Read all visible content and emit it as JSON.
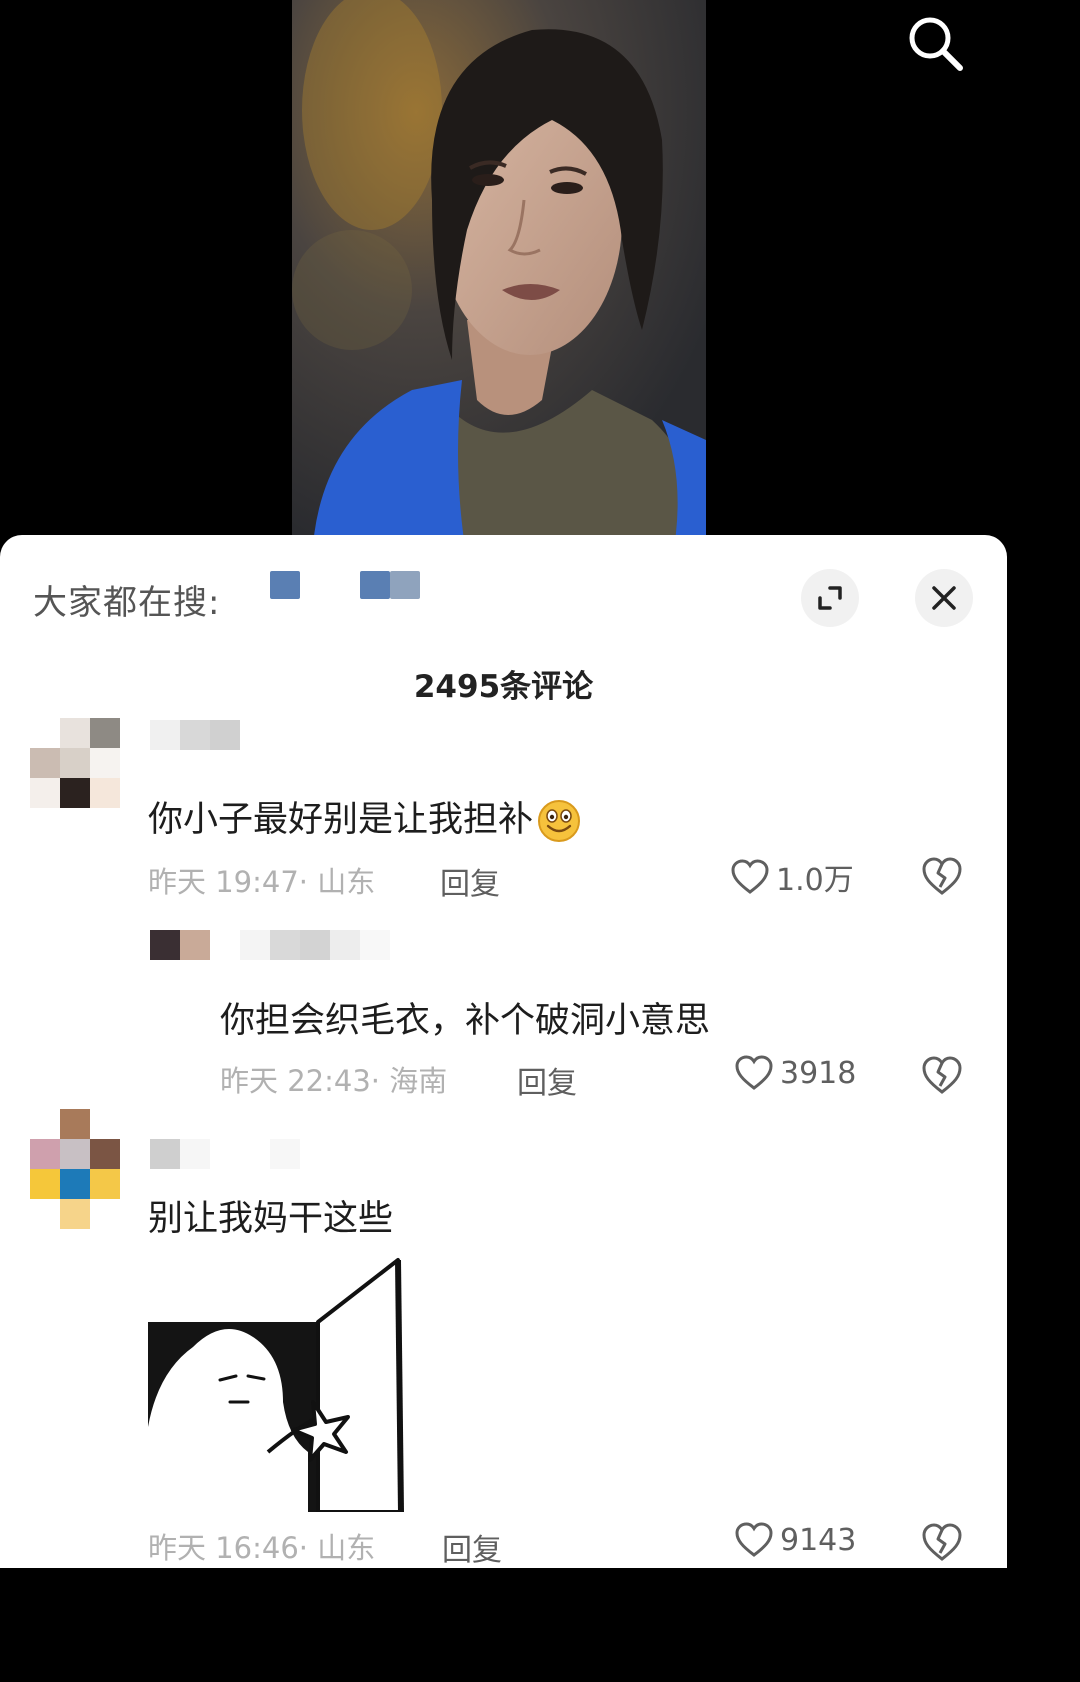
{
  "colors": {
    "sheet_bg": "#ffffff",
    "primary_text": "#1d1d1d",
    "secondary_text": "#b1b1b1",
    "action_text": "#5f5f5f",
    "jacket_blue": "#2a5fd0"
  },
  "icons": {
    "search": "search-icon",
    "expand": "expand-icon",
    "close": "close-icon",
    "like": "heart-icon",
    "dislike": "broken-heart-icon",
    "emoji": "smile-emoji"
  },
  "sheet": {
    "search_hint": "大家都在搜:",
    "comment_count": "2495条评论"
  },
  "comments": [
    {
      "text": "你小子最好别是让我担补",
      "emoji": "smile-emoji",
      "time": "昨天 19:47",
      "location": "山东",
      "reply_label": "回复",
      "likes": "1.0万",
      "replies": [
        {
          "text": "你担会织毛衣，补个破洞小意思",
          "time": "昨天 22:43",
          "location": "海南",
          "reply_label": "回复",
          "likes": "3918"
        }
      ]
    },
    {
      "text": "别让我妈干这些",
      "sticker": "cat-door-meme-sticker",
      "time": "昨天 16:46",
      "location": "山东",
      "reply_label": "回复",
      "likes": "9143"
    }
  ]
}
